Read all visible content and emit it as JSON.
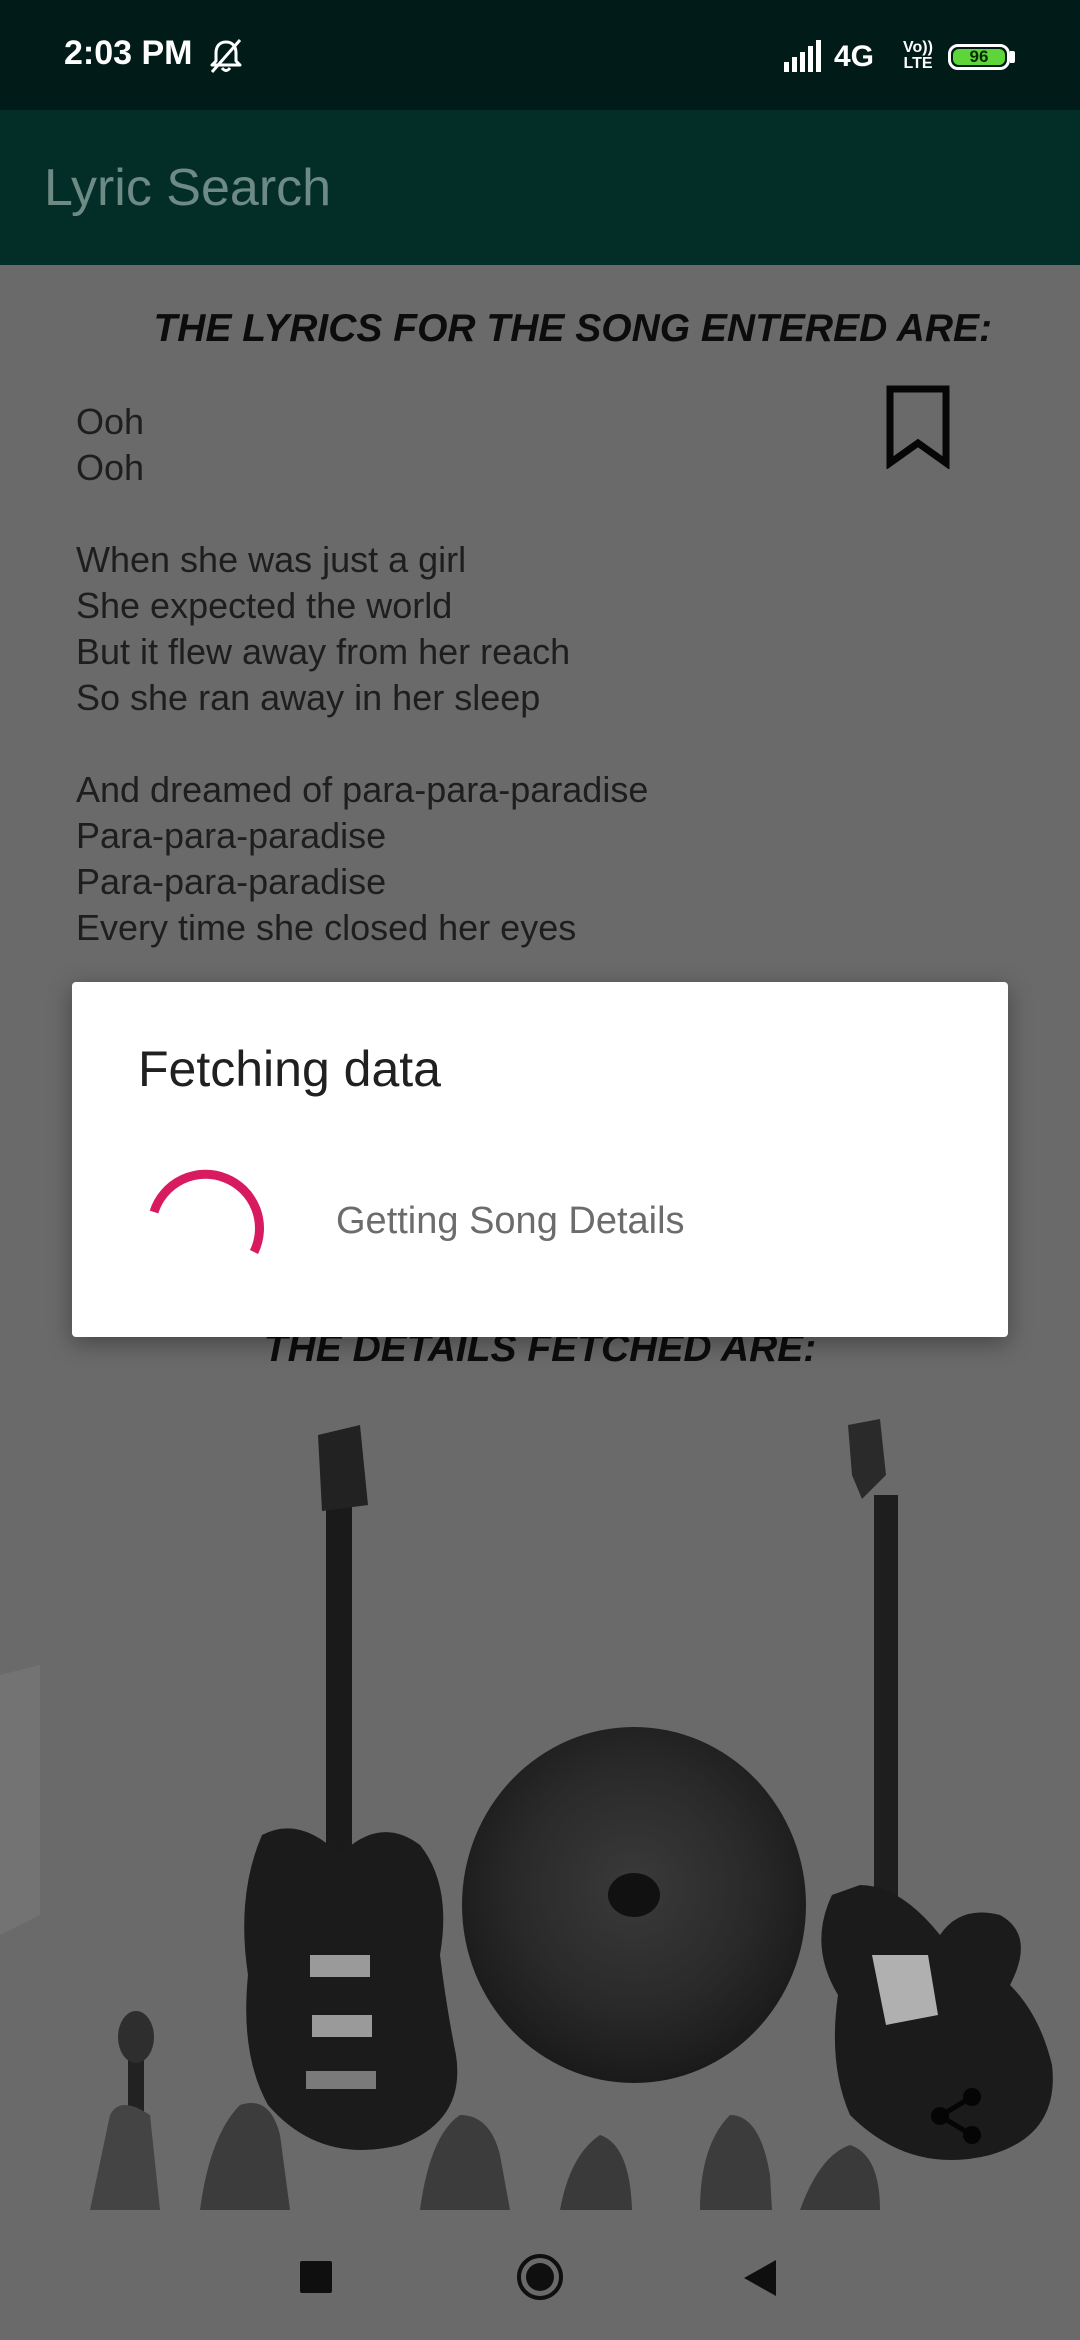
{
  "status_bar": {
    "time": "2:03 PM",
    "network": "4G",
    "volte_line1": "Vo))",
    "volte_line2": "LTE",
    "battery": "96"
  },
  "app_bar": {
    "title": "Lyric Search"
  },
  "content": {
    "lyrics_heading": "THE LYRICS FOR THE SONG ENTERED ARE:",
    "lyrics": "Ooh\nOoh\n\nWhen she was just a girl\nShe expected the world\nBut it flew away from her reach\nSo she ran away in her sleep\n\nAnd dreamed of para-para-paradise\nPara-para-paradise\nPara-para-paradise\nEvery time she closed her eyes",
    "details_heading": "THE DETAILS FETCHED ARE:"
  },
  "dialog": {
    "title": "Fetching data",
    "message": "Getting Song Details",
    "spinner_color": "#d81b60"
  },
  "colors": {
    "status_bar": "#011c18",
    "app_bar": "#032e28",
    "scrim_background": "#6a6a6a",
    "battery_fill": "#5ed63a"
  },
  "icons": {
    "mute": "bell-off-icon",
    "signal": "signal-bars-icon",
    "battery": "battery-icon",
    "bookmark": "bookmark-icon",
    "share": "share-icon",
    "spinner": "loading-spinner-icon",
    "recents": "square-icon",
    "home": "circle-icon",
    "back": "triangle-back-icon"
  }
}
